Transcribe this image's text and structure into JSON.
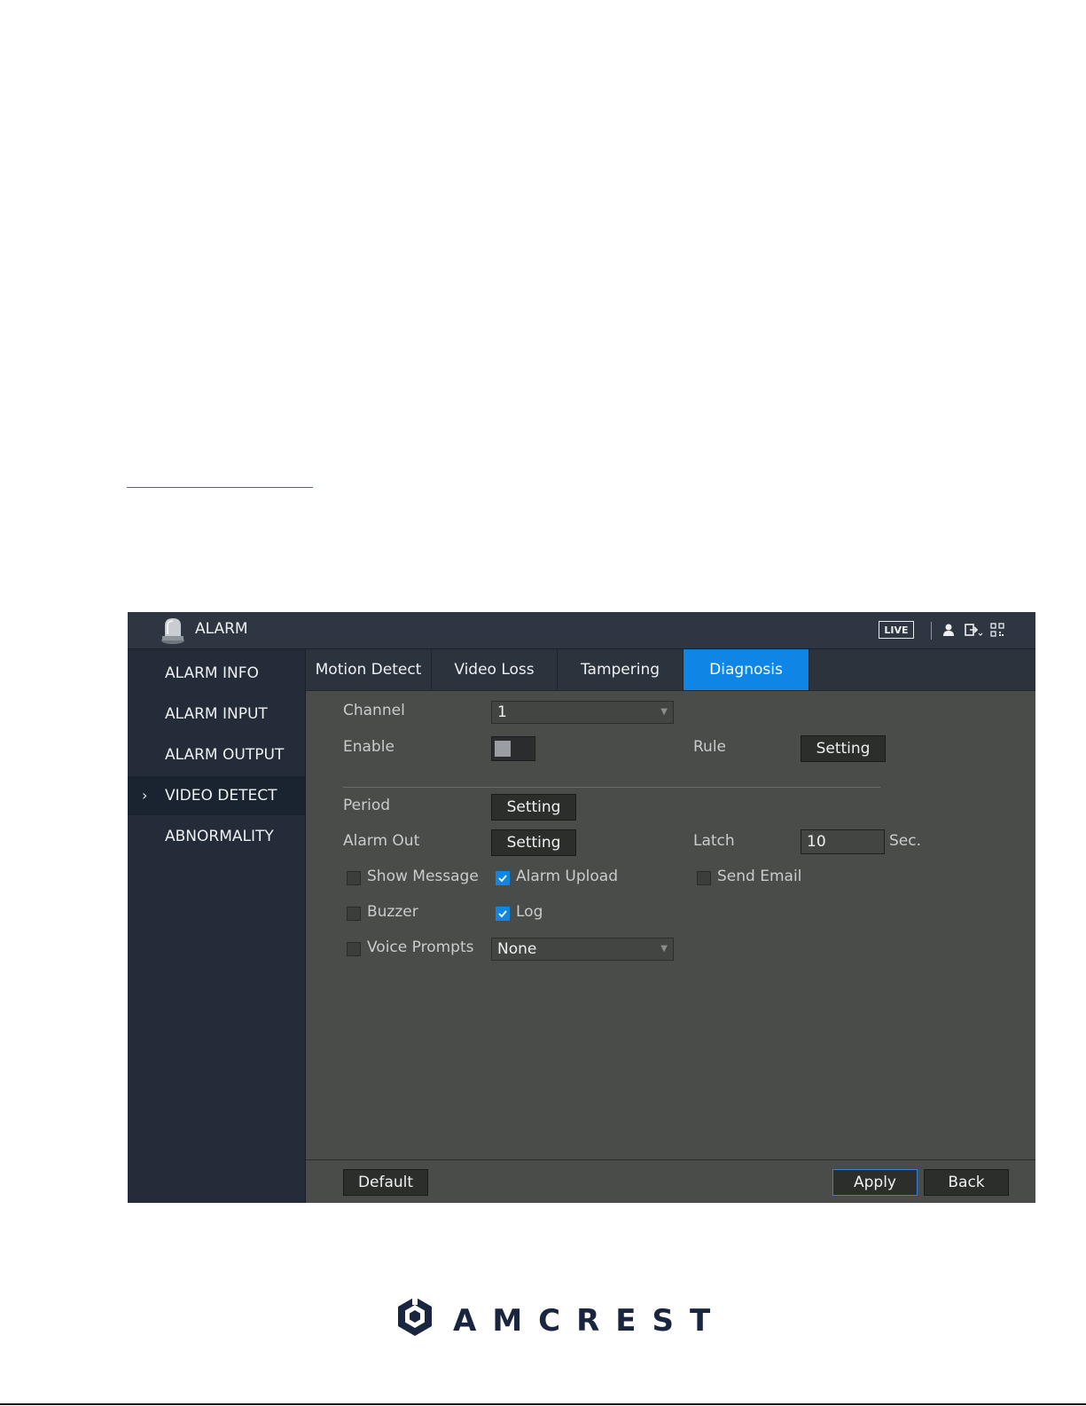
{
  "window": {
    "title": "ALARM",
    "live_label": "LIVE"
  },
  "sidebar": {
    "items": [
      {
        "label": "ALARM INFO"
      },
      {
        "label": "ALARM INPUT"
      },
      {
        "label": "ALARM OUTPUT"
      },
      {
        "label": "VIDEO DETECT",
        "active": true
      },
      {
        "label": "ABNORMALITY"
      }
    ]
  },
  "tabs": [
    {
      "label": "Motion Detect"
    },
    {
      "label": "Video Loss"
    },
    {
      "label": "Tampering"
    },
    {
      "label": "Diagnosis",
      "active": true
    }
  ],
  "form": {
    "channel_label": "Channel",
    "channel_value": "1",
    "enable_label": "Enable",
    "enable_on": false,
    "rule_label": "Rule",
    "rule_button": "Setting",
    "period_label": "Period",
    "period_button": "Setting",
    "alarm_out_label": "Alarm Out",
    "alarm_out_button": "Setting",
    "latch_label": "Latch",
    "latch_value": "10",
    "latch_unit": "Sec.",
    "show_message_label": "Show Message",
    "show_message_checked": false,
    "alarm_upload_label": "Alarm Upload",
    "alarm_upload_checked": true,
    "send_email_label": "Send Email",
    "send_email_checked": false,
    "buzzer_label": "Buzzer",
    "buzzer_checked": false,
    "log_label": "Log",
    "log_checked": true,
    "voice_prompts_label": "Voice Prompts",
    "voice_prompts_checked": false,
    "voice_prompts_value": "None"
  },
  "footer": {
    "default_button": "Default",
    "apply_button": "Apply",
    "back_button": "Back"
  },
  "logo": {
    "text": "AMCREST"
  },
  "colors": {
    "accent": "#0f85e6",
    "panel": "#4a4c4a",
    "sidebar": "#232c38"
  }
}
